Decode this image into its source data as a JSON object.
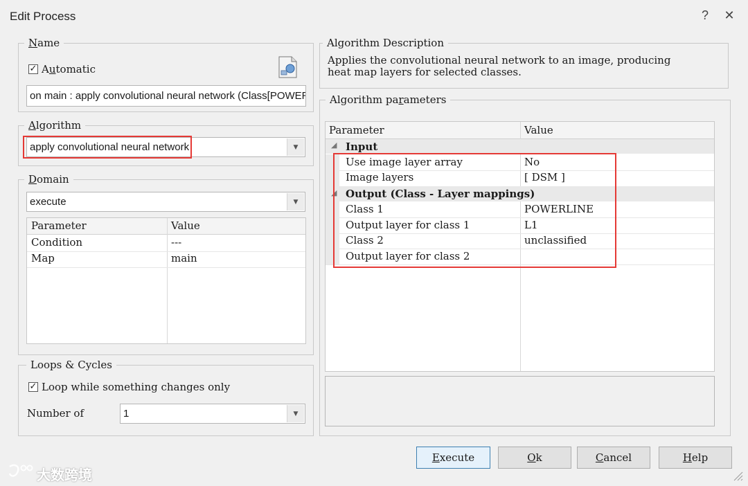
{
  "window": {
    "title": "Edit Process",
    "help_glyph": "?",
    "close_glyph": "✕"
  },
  "name_group": {
    "legend": "Name",
    "automatic_label": "Automatic",
    "automatic_checked": true,
    "name_value": "on main : apply convolutional neural network (Class[POWERLINE"
  },
  "algorithm_group": {
    "legend": "Algorithm",
    "selected": "apply convolutional neural network"
  },
  "domain_group": {
    "legend": "Domain",
    "selected": "execute",
    "columns": [
      "Parameter",
      "Value"
    ],
    "rows": [
      {
        "parameter": "Condition",
        "value": "---"
      },
      {
        "parameter": "Map",
        "value": "main"
      }
    ]
  },
  "loops_group": {
    "legend": "Loops & Cycles",
    "loop_label": "Loop while something changes only",
    "loop_checked": true,
    "number_of_label": "Number of",
    "number_of_value": "1"
  },
  "description_group": {
    "legend": "Algorithm Description",
    "line1": "Applies the convolutional neural network to an image, producing",
    "line2": "heat map layers for selected classes."
  },
  "parameters_group": {
    "legend": "Algorithm parameters",
    "columns": [
      "Parameter",
      "Value"
    ],
    "sections": [
      {
        "title": "Input",
        "rows": [
          {
            "parameter": "Use image layer array",
            "value": "No"
          },
          {
            "parameter": "Image layers",
            "value": "[ DSM ]"
          }
        ]
      },
      {
        "title": "Output (Class - Layer mappings)",
        "rows": [
          {
            "parameter": "Class 1",
            "value": "POWERLINE"
          },
          {
            "parameter": "Output layer for class 1",
            "value": "L1"
          },
          {
            "parameter": "Class 2",
            "value": "unclassified"
          },
          {
            "parameter": "Output layer for class 2",
            "value": ""
          }
        ]
      }
    ]
  },
  "buttons": {
    "execute": "Execute",
    "ok": "Ok",
    "cancel": "Cancel",
    "help": "Help"
  },
  "watermark": "大数跨境",
  "colors": {
    "highlight": "#e53935",
    "primary_border": "#3c7fb1"
  }
}
